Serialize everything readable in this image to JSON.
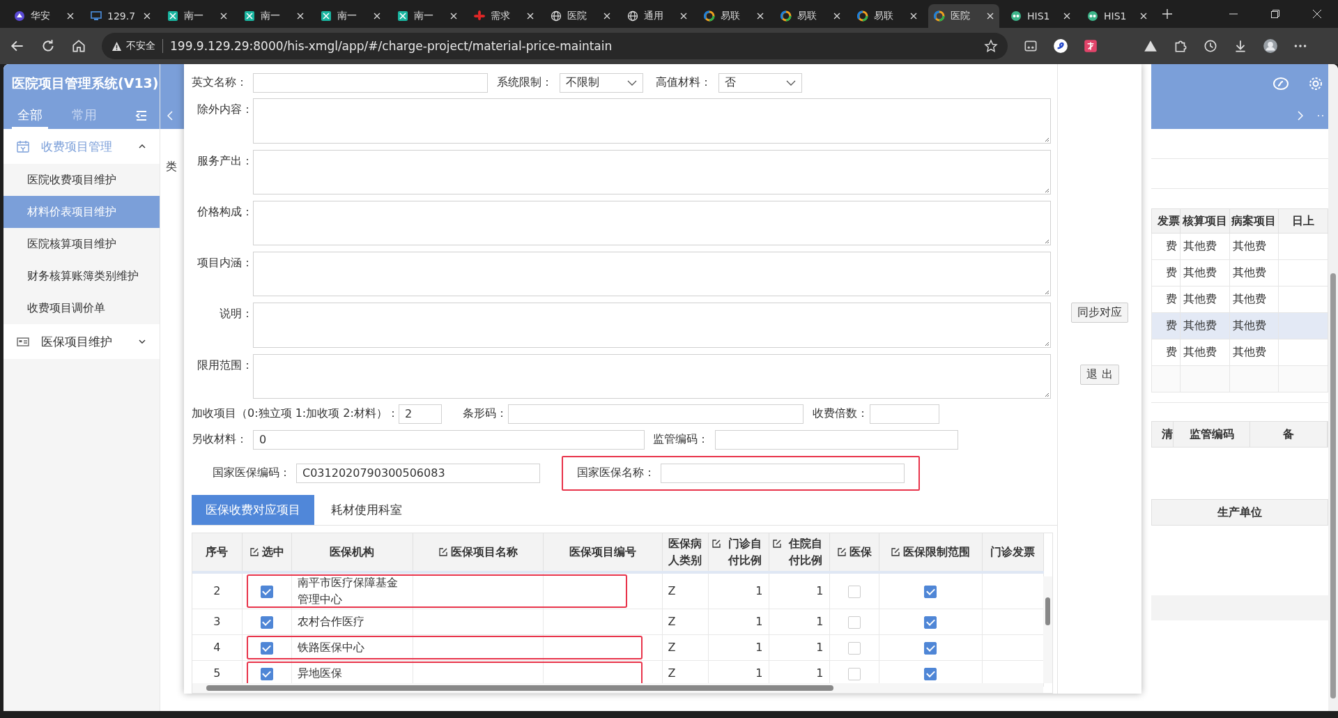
{
  "browser": {
    "tabs": [
      {
        "title": "华安",
        "kind": "logo",
        "selected": false
      },
      {
        "title": "129.7",
        "kind": "monitor",
        "selected": false
      },
      {
        "title": "南一",
        "kind": "app",
        "selected": false
      },
      {
        "title": "南一",
        "kind": "app",
        "selected": false
      },
      {
        "title": "南一",
        "kind": "app",
        "selected": false
      },
      {
        "title": "南一",
        "kind": "app",
        "selected": false
      },
      {
        "title": "需求",
        "kind": "petals",
        "selected": false
      },
      {
        "title": "医院",
        "kind": "globe",
        "selected": false
      },
      {
        "title": "通用",
        "kind": "globe",
        "selected": false
      },
      {
        "title": "易联",
        "kind": "ring",
        "selected": false
      },
      {
        "title": "易联",
        "kind": "ring",
        "selected": false
      },
      {
        "title": "易联",
        "kind": "ring",
        "selected": false
      },
      {
        "title": "医院",
        "kind": "ring",
        "selected": true
      },
      {
        "title": "HIS1",
        "kind": "eyes",
        "selected": false
      },
      {
        "title": "HIS1",
        "kind": "eyes",
        "selected": false
      }
    ],
    "security_label": "不安全",
    "url": "199.9.129.29:8000/his-xmgl/app/#/charge-project/material-price-maintain"
  },
  "sidebar": {
    "title": "医院项目管理系统(V13)",
    "tabs": [
      {
        "label": "全部",
        "selected": true
      },
      {
        "label": "常用",
        "selected": false
      }
    ],
    "menu": [
      {
        "label": "收费项目管理",
        "kind": "charge",
        "expanded": true,
        "children": [
          {
            "label": "医院收费项目维护",
            "selected": false
          },
          {
            "label": "材料价表项目维护",
            "selected": true
          },
          {
            "label": "医院核算项目维护",
            "selected": false
          },
          {
            "label": "财务核算账簿类别维护",
            "selected": false
          },
          {
            "label": "收费项目调价单",
            "selected": false
          }
        ]
      },
      {
        "label": "医保项目维护",
        "kind": "card",
        "expanded": false
      }
    ]
  },
  "background": {
    "side_text": "类",
    "table_1": {
      "columns": [
        "发票",
        "核算项目",
        "病案项目",
        "日上"
      ],
      "rows": [
        {
          "cells": [
            "费",
            "其他费",
            "其他费"
          ],
          "selected": false
        },
        {
          "cells": [
            "费",
            "其他费",
            "其他费"
          ],
          "selected": false
        },
        {
          "cells": [
            "费",
            "其他费",
            "其他费"
          ],
          "selected": false
        },
        {
          "cells": [
            "费",
            "其他费",
            "其他费"
          ],
          "selected": true
        },
        {
          "cells": [
            "费",
            "其他费",
            "其他费"
          ],
          "selected": false
        }
      ]
    },
    "table_2": {
      "columns": [
        "清",
        "监管编码",
        "备"
      ]
    },
    "table_3": {
      "columns": [
        "生产单位"
      ]
    }
  },
  "dialog": {
    "top_fields": [
      {
        "kind": "text",
        "label": "英文名称："
      },
      {
        "kind": "select",
        "label": "系统限制：",
        "value": "不限制"
      },
      {
        "kind": "select",
        "label": "高值材料：",
        "value": "否"
      }
    ],
    "text_areas": [
      {
        "label": "除外内容："
      },
      {
        "label": "服务产出："
      },
      {
        "label": "价格构成："
      },
      {
        "label": "项目内涵："
      },
      {
        "label": "说明："
      },
      {
        "label": "限用范围："
      }
    ],
    "surcharge_row": [
      {
        "label": "加收项目（0:独立项 1:加收项 2:材料）：",
        "value": "2"
      },
      {
        "label": "条形码："
      },
      {
        "label": "收费倍数："
      }
    ],
    "material_row": [
      {
        "label": "另收材料：",
        "value": "0"
      },
      {
        "label": "监管编码："
      }
    ],
    "code_row": [
      {
        "label": "国家医保编码：",
        "value": "C0312020790300506083",
        "highlighted": false
      },
      {
        "label": "国家医保名称：",
        "highlighted": true
      }
    ],
    "tabs": [
      {
        "label": "医保收费对应项目",
        "selected": true
      },
      {
        "label": "耗材使用科室",
        "selected": false
      }
    ],
    "table": {
      "columns": [
        {
          "label": "序号",
          "kind": "plain"
        },
        {
          "label": "选中",
          "kind": "edit"
        },
        {
          "label": "医保机构",
          "kind": "plain"
        },
        {
          "label": "医保项目名称",
          "kind": "edit"
        },
        {
          "label": "医保项目编号",
          "kind": "plain"
        },
        {
          "label": "医保病人类别",
          "kind": "plain"
        },
        {
          "label": "门诊自付比例",
          "kind": "edit"
        },
        {
          "label": "住院自付比例",
          "kind": "edit"
        },
        {
          "label": "医保",
          "kind": "edit"
        },
        {
          "label": "医保限制范围",
          "kind": "edit"
        },
        {
          "label": "门诊发票",
          "kind": "plain"
        }
      ],
      "rows": [
        {
          "number": "2",
          "checked": true,
          "institution": "南平市医疗保障基金管理中心",
          "patient_type": "Z",
          "outpatient_ratio": "1",
          "inpatient_ratio": "1",
          "insured": false,
          "limit_scope": true,
          "highlighted": true
        },
        {
          "number": "3",
          "checked": true,
          "institution": "农村合作医疗",
          "patient_type": "Z",
          "outpatient_ratio": "1",
          "inpatient_ratio": "1",
          "insured": false,
          "limit_scope": true,
          "highlighted": false
        },
        {
          "number": "4",
          "checked": true,
          "institution": "铁路医保中心",
          "patient_type": "Z",
          "outpatient_ratio": "1",
          "inpatient_ratio": "1",
          "insured": false,
          "limit_scope": true,
          "highlighted": true
        },
        {
          "number": "5",
          "checked": true,
          "institution": "异地医保",
          "patient_type": "Z",
          "outpatient_ratio": "1",
          "inpatient_ratio": "1",
          "insured": false,
          "limit_scope": true,
          "highlighted": true
        }
      ]
    },
    "buttons": [
      "同步对应",
      "退 出"
    ]
  }
}
